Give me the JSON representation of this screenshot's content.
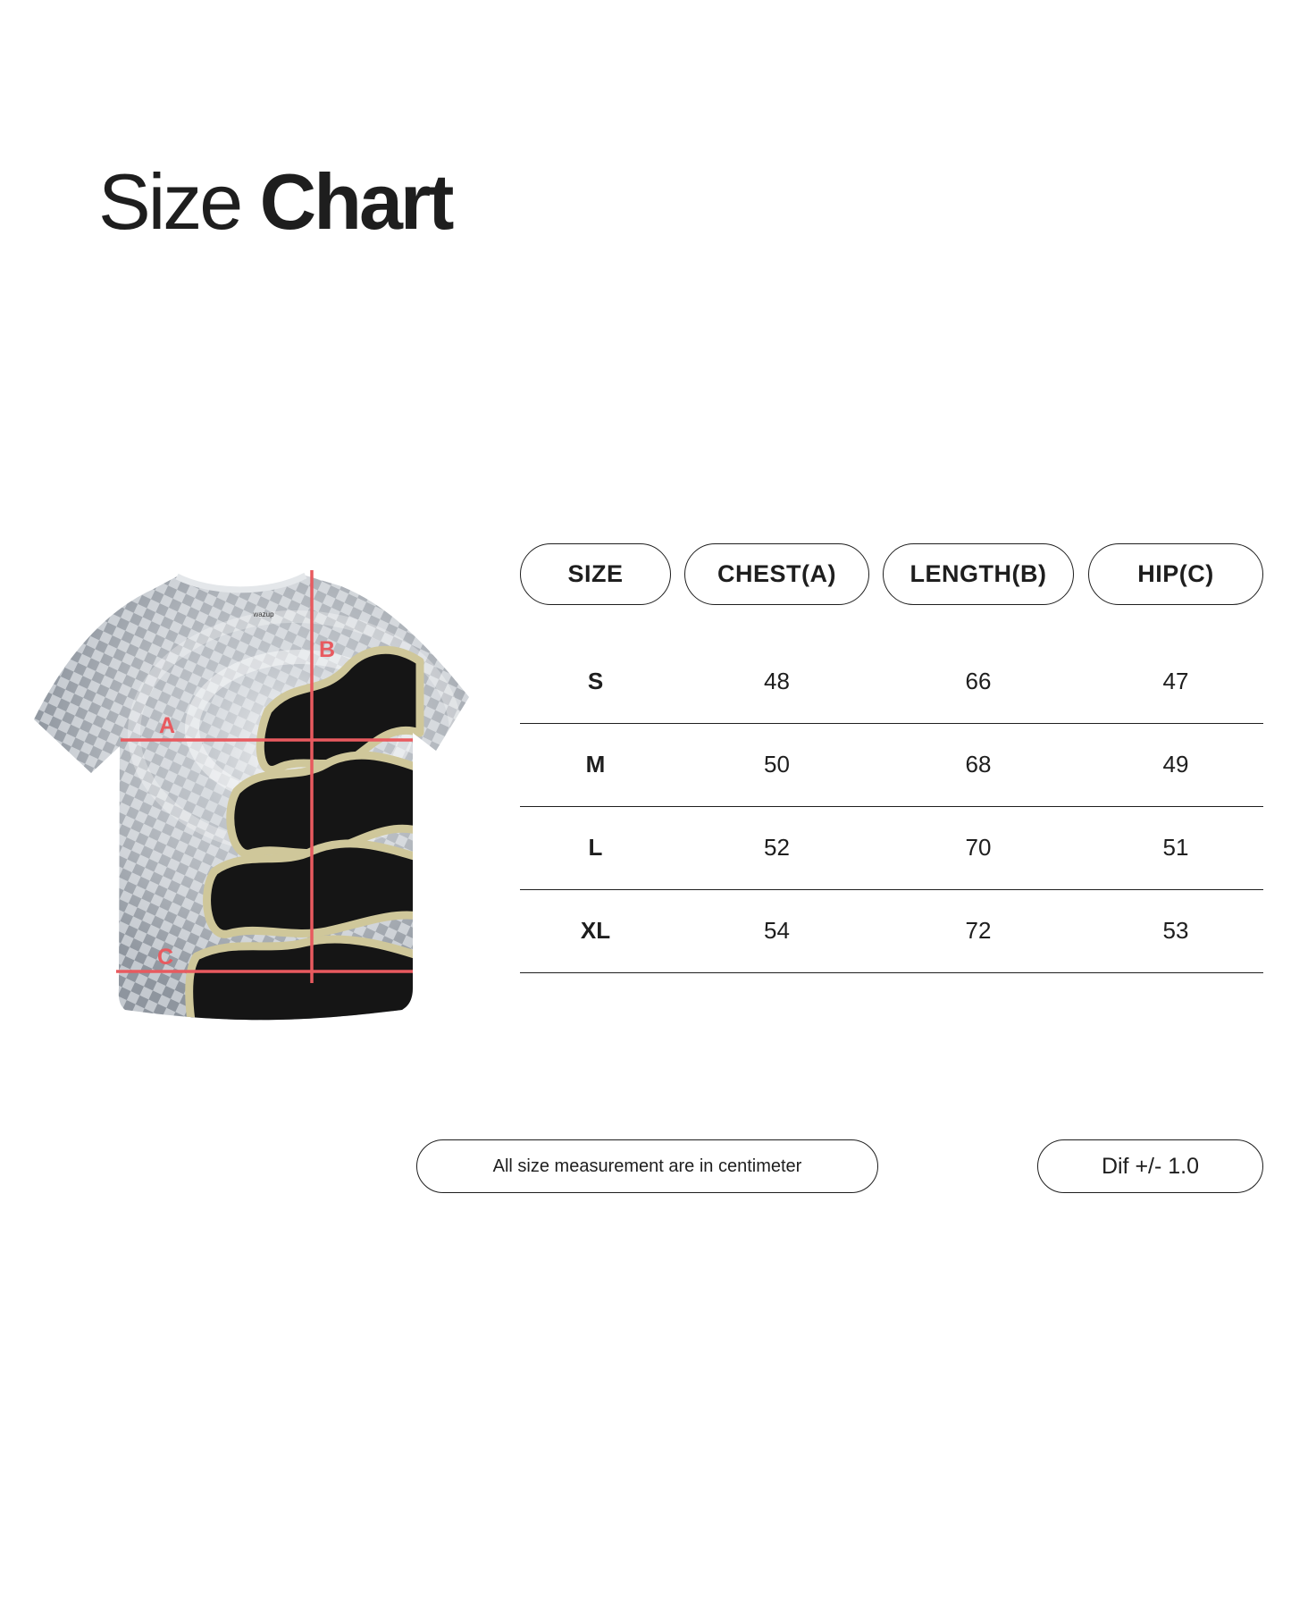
{
  "title": {
    "light": "Size",
    "bold": "Chart"
  },
  "diagram": {
    "labels": {
      "chest": "A",
      "length": "B",
      "hip": "C"
    },
    "tag_text": "wazup",
    "colors": {
      "measure_line": "#e85a5f",
      "shirt_base": "#a9b0b9",
      "shirt_light": "#d6dadf",
      "print_cream": "#cfc79a",
      "print_black": "#151515"
    }
  },
  "table": {
    "headers": [
      "SIZE",
      "CHEST(A)",
      "LENGTH(B)",
      "HIP(C)"
    ],
    "rows": [
      {
        "size": "S",
        "chest": "48",
        "length": "66",
        "hip": "47"
      },
      {
        "size": "M",
        "chest": "50",
        "length": "68",
        "hip": "49"
      },
      {
        "size": "L",
        "chest": "52",
        "length": "70",
        "hip": "51"
      },
      {
        "size": "XL",
        "chest": "54",
        "length": "72",
        "hip": "53"
      }
    ]
  },
  "footer": {
    "note": "All size measurement are in centimeter",
    "tolerance": "Dif +/- 1.0"
  }
}
